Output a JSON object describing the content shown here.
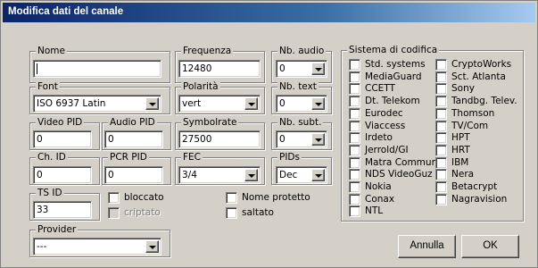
{
  "window": {
    "title": "Modifica dati del canale"
  },
  "fields": {
    "nome": {
      "label": "Nome",
      "value": ""
    },
    "frequenza": {
      "label": "Frequenza",
      "value": "12480"
    },
    "nb_audio": {
      "label": "Nb. audio",
      "value": "0"
    },
    "font": {
      "label": "Font",
      "value": "ISO 6937 Latin"
    },
    "polarita": {
      "label": "Polarità",
      "value": "vert"
    },
    "nb_text": {
      "label": "Nb. text",
      "value": "0"
    },
    "video_pid": {
      "label": "Video PID",
      "value": "0"
    },
    "audio_pid": {
      "label": "Audio PID",
      "value": "0"
    },
    "symbolrate": {
      "label": "Symbolrate",
      "value": "27500"
    },
    "nb_subt": {
      "label": "Nb. subt.",
      "value": "0"
    },
    "ch_id": {
      "label": "Ch. ID",
      "value": "0"
    },
    "pcr_pid": {
      "label": "PCR PID",
      "value": "0"
    },
    "fec": {
      "label": "FEC",
      "value": "3/4"
    },
    "pids": {
      "label": "PIDs",
      "value": "Dec"
    },
    "ts_id": {
      "label": "TS ID",
      "value": "33"
    },
    "provider": {
      "label": "Provider",
      "value": "---"
    }
  },
  "checks": {
    "bloccato": {
      "label": "bloccato",
      "checked": false
    },
    "criptato": {
      "label": "criptato",
      "checked": false,
      "disabled": true
    },
    "nome_protetto": {
      "label": "Nome protetto",
      "checked": false
    },
    "saltato": {
      "label": "saltato",
      "checked": false
    }
  },
  "sistema": {
    "label": "Sistema di codifica",
    "col1": [
      "Std. systems",
      "MediaGuard",
      "CCETT",
      "Dt. Telekom",
      "Eurodec",
      "Viaccess",
      "Irdeto",
      "Jerrold/GI",
      "Matra Commun",
      "NDS VideoGuz",
      "Nokia",
      "Conax",
      "NTL"
    ],
    "col2": [
      "CryptoWorks",
      "Sct. Atlanta",
      "Sony",
      "Tandbg. Telev.",
      "Thomson",
      "TV/Com",
      "HPT",
      "HRT",
      "IBM",
      "Nera",
      "Betacrypt",
      "Nagravision"
    ]
  },
  "buttons": {
    "cancel": "Annulla",
    "ok": "OK"
  }
}
